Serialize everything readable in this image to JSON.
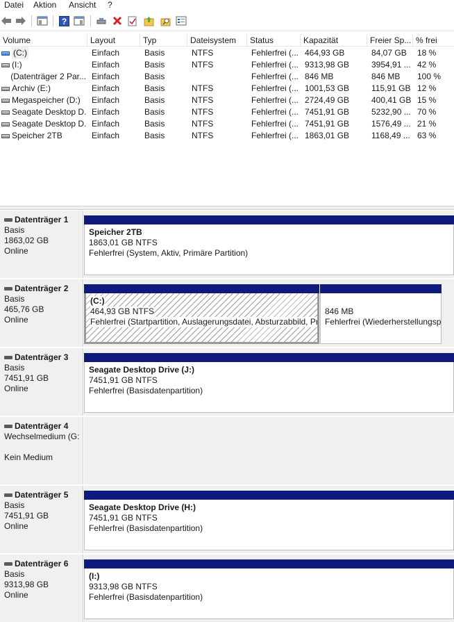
{
  "menu": [
    "Datei",
    "Aktion",
    "Ansicht",
    "?"
  ],
  "toolbar": [
    "back-icon",
    "forward-icon",
    "console-tree-icon",
    "help-icon",
    "view-icon",
    "connect-icon",
    "delete-icon",
    "check-icon",
    "open-folder-icon",
    "search-folder-icon",
    "properties-icon"
  ],
  "columns": [
    "Volume",
    "Layout",
    "Typ",
    "Dateisystem",
    "Status",
    "Kapazität",
    "Freier Sp...",
    "% frei"
  ],
  "volumes": [
    {
      "name": "(C:)",
      "icon": "blue",
      "layout": "Einfach",
      "typ": "Basis",
      "fs": "NTFS",
      "status": "Fehlerfrei (...",
      "cap": "464,93 GB",
      "free": "84,07 GB",
      "pct": "18 %"
    },
    {
      "name": "(I:)",
      "icon": "gray",
      "layout": "Einfach",
      "typ": "Basis",
      "fs": "NTFS",
      "status": "Fehlerfrei (...",
      "cap": "9313,98 GB",
      "free": "3954,91 ...",
      "pct": "42 %"
    },
    {
      "name": "(Datenträger 2 Par...",
      "icon": "none",
      "layout": "Einfach",
      "typ": "Basis",
      "fs": "",
      "status": "Fehlerfrei (...",
      "cap": "846 MB",
      "free": "846 MB",
      "pct": "100 %"
    },
    {
      "name": "Archiv (E:)",
      "icon": "gray",
      "layout": "Einfach",
      "typ": "Basis",
      "fs": "NTFS",
      "status": "Fehlerfrei (...",
      "cap": "1001,53 GB",
      "free": "115,91 GB",
      "pct": "12 %"
    },
    {
      "name": "Megaspeicher (D:)",
      "icon": "gray",
      "layout": "Einfach",
      "typ": "Basis",
      "fs": "NTFS",
      "status": "Fehlerfrei (...",
      "cap": "2724,49 GB",
      "free": "400,41 GB",
      "pct": "15 %"
    },
    {
      "name": "Seagate Desktop D...",
      "icon": "gray",
      "layout": "Einfach",
      "typ": "Basis",
      "fs": "NTFS",
      "status": "Fehlerfrei (...",
      "cap": "7451,91 GB",
      "free": "5232,90 ...",
      "pct": "70 %"
    },
    {
      "name": "Seagate Desktop D...",
      "icon": "gray",
      "layout": "Einfach",
      "typ": "Basis",
      "fs": "NTFS",
      "status": "Fehlerfrei (...",
      "cap": "7451,91 GB",
      "free": "1576,49 ...",
      "pct": "21 %"
    },
    {
      "name": "Speicher 2TB",
      "icon": "gray",
      "layout": "Einfach",
      "typ": "Basis",
      "fs": "NTFS",
      "status": "Fehlerfrei (...",
      "cap": "1863,01 GB",
      "free": "1168,49 ...",
      "pct": "63 %"
    }
  ],
  "disks": [
    {
      "title": "Datenträger 1",
      "line1": "Basis",
      "line2": "1863,02 GB",
      "line3": "Online",
      "parts": [
        {
          "title": "Speicher 2TB",
          "size": "1863,01 GB NTFS",
          "status": "Fehlerfrei (System, Aktiv, Primäre Partition)"
        }
      ]
    },
    {
      "title": "Datenträger 2",
      "line1": "Basis",
      "line2": "465,76 GB",
      "line3": "Online",
      "parts": [
        {
          "title": "(C:)",
          "size": "464,93 GB NTFS",
          "status": "Fehlerfrei (Startpartition, Auslagerungsdatei, Absturzabbild, Pr"
        },
        {
          "title": "",
          "size": "846 MB",
          "status": "Fehlerfrei (Wiederherstellungsp"
        }
      ]
    },
    {
      "title": "Datenträger 3",
      "line1": "Basis",
      "line2": "7451,91 GB",
      "line3": "Online",
      "parts": [
        {
          "title": "Seagate Desktop Drive  (J:)",
          "size": "7451,91 GB NTFS",
          "status": "Fehlerfrei (Basisdatenpartition)"
        }
      ]
    },
    {
      "title": "Datenträger 4",
      "line1": "Wechselmedium (G:",
      "line2": "",
      "line3": "Kein Medium",
      "parts": []
    },
    {
      "title": "Datenträger 5",
      "line1": "Basis",
      "line2": "7451,91 GB",
      "line3": "Online",
      "parts": [
        {
          "title": "Seagate Desktop Drive  (H:)",
          "size": "7451,91 GB NTFS",
          "status": "Fehlerfrei (Basisdatenpartition)"
        }
      ]
    },
    {
      "title": "Datenträger 6",
      "line1": "Basis",
      "line2": "9313,98 GB",
      "line3": "Online",
      "parts": [
        {
          "title": "(I:)",
          "size": "9313,98 GB NTFS",
          "status": "Fehlerfrei (Basisdatenpartition)"
        }
      ]
    }
  ],
  "colors": {
    "partition_bar": "#0e1a7c",
    "panel_bg": "#f0f0f0"
  }
}
